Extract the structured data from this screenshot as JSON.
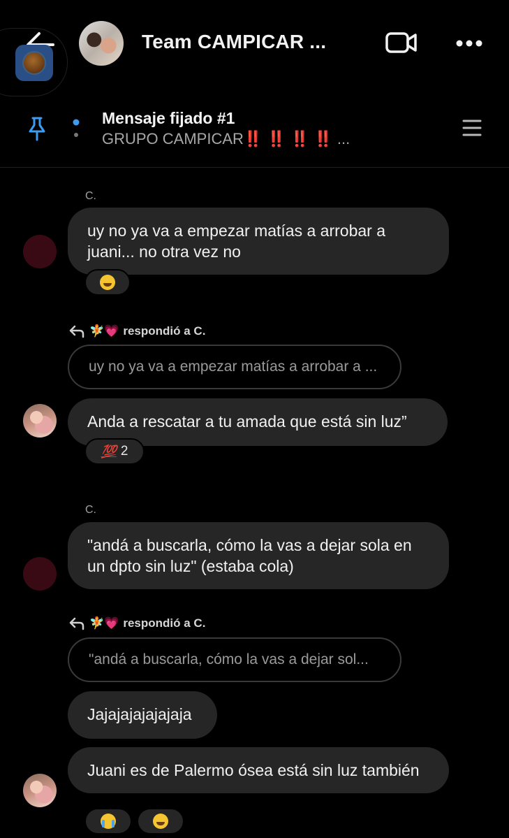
{
  "header": {
    "title": "Team CAMPICAR ...",
    "icons": [
      "back-arrow-icon",
      "video-call-icon",
      "more-options-icon"
    ]
  },
  "pinned": {
    "title": "Mensaje fijado #1",
    "text": "GRUPO CAMPICAR‼️ ‼️ ‼️ ‼️ ...",
    "icons": [
      "pin-icon",
      "list-menu-icon"
    ]
  },
  "messages": [
    {
      "sender": "C.",
      "text": "uy no ya va a empezar matías a arrobar a juani... no otra vez no",
      "reactions": [
        {
          "emoji": "😂",
          "count": ""
        }
      ]
    },
    {
      "reply_label": "respondió a C.",
      "reply_prefix": "🧚💗",
      "quote": "uy no ya va a empezar matías a arrobar a ...",
      "text": "Anda a rescatar a tu amada que está sin luz”",
      "reactions": [
        {
          "emoji": "💯",
          "count": "2"
        }
      ]
    },
    {
      "sender": "C.",
      "text": "\"andá a buscarla, cómo la vas a dejar sola en un dpto sin luz\" (estaba cola)"
    },
    {
      "reply_label": "respondió a C.",
      "reply_prefix": "🧚💗",
      "quote": "\"andá a buscarla, cómo la vas a dejar sol...",
      "text": "Jajajajajajajaja"
    },
    {
      "text": "Juani es de Palermo ósea está sin luz también",
      "reactions": [
        {
          "emoji": "😭",
          "count": ""
        },
        {
          "emoji": "😂",
          "count": ""
        }
      ]
    }
  ]
}
